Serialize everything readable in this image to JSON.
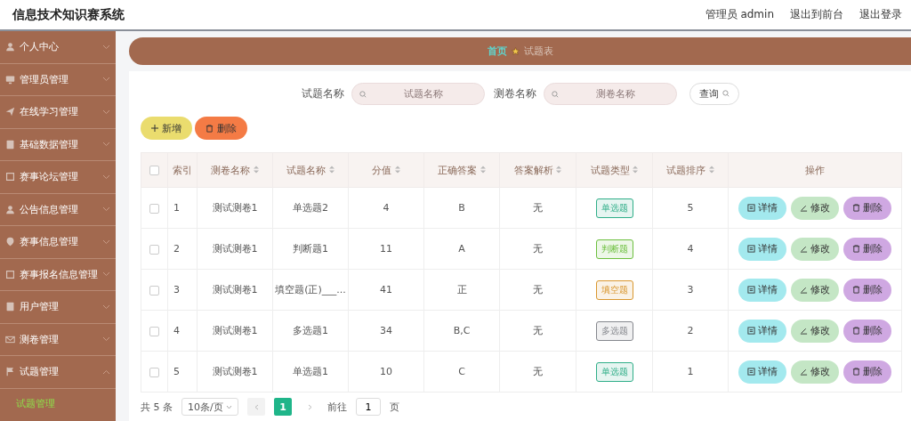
{
  "header": {
    "title": "信息技术知识赛系统",
    "user": "管理员 admin",
    "links": [
      "退出到前台",
      "退出登录"
    ]
  },
  "sidebar": {
    "items": [
      {
        "label": "个人中心",
        "expanded": false
      },
      {
        "label": "管理员管理",
        "expanded": false
      },
      {
        "label": "在线学习管理",
        "expanded": false
      },
      {
        "label": "基础数据管理",
        "expanded": false
      },
      {
        "label": "赛事论坛管理",
        "expanded": false
      },
      {
        "label": "公告信息管理",
        "expanded": false
      },
      {
        "label": "赛事信息管理",
        "expanded": false
      },
      {
        "label": "赛事报名信息管理",
        "expanded": false
      },
      {
        "label": "用户管理",
        "expanded": false
      },
      {
        "label": "测卷管理",
        "expanded": false
      },
      {
        "label": "试题管理",
        "expanded": true,
        "children": [
          {
            "label": "试题管理",
            "selected": true
          }
        ]
      }
    ]
  },
  "breadcrumb": {
    "home": "首页",
    "current": "试题表"
  },
  "search": {
    "fields": [
      {
        "label": "试题名称",
        "placeholder": "试题名称"
      },
      {
        "label": "测卷名称",
        "placeholder": "测卷名称"
      }
    ],
    "button": "查询"
  },
  "actions": {
    "add": "新增",
    "delete": "删除"
  },
  "table": {
    "header_checked": false,
    "columns": [
      {
        "label": "索引",
        "sortable": false
      },
      {
        "label": "测卷名称",
        "sortable": true
      },
      {
        "label": "试题名称",
        "sortable": true
      },
      {
        "label": "分值",
        "sortable": true
      },
      {
        "label": "正确答案",
        "sortable": true
      },
      {
        "label": "答案解析",
        "sortable": true
      },
      {
        "label": "试题类型",
        "sortable": true
      },
      {
        "label": "试题排序",
        "sortable": true
      },
      {
        "label": "操作",
        "sortable": false
      }
    ],
    "rows": [
      {
        "checked": false,
        "index": "1",
        "paper": "测试测卷1",
        "name": "单选题2",
        "score": "4",
        "answer": "B",
        "analysis": "无",
        "type": {
          "text": "单选题",
          "color": "#2fae88"
        },
        "order": "5",
        "buttons": [
          "详情",
          "修改",
          "删除"
        ]
      },
      {
        "checked": false,
        "index": "2",
        "paper": "测试测卷1",
        "name": "判断题1",
        "score": "11",
        "answer": "A",
        "analysis": "无",
        "type": {
          "text": "判断题",
          "color": "#6cbf3e"
        },
        "order": "4",
        "buttons": [
          "详情",
          "修改",
          "删除"
        ]
      },
      {
        "checked": false,
        "index": "3",
        "paper": "测试测卷1",
        "name": "填空题(正)___...",
        "score": "41",
        "answer": "正",
        "analysis": "无",
        "type": {
          "text": "填空题",
          "color": "#d9972f"
        },
        "order": "3",
        "buttons": [
          "详情",
          "修改",
          "删除"
        ]
      },
      {
        "checked": false,
        "index": "4",
        "paper": "测试测卷1",
        "name": "多选题1",
        "score": "34",
        "answer": "B,C",
        "analysis": "无",
        "type": {
          "text": "多选题",
          "color": "#85878d"
        },
        "order": "2",
        "buttons": [
          "详情",
          "修改",
          "删除"
        ]
      },
      {
        "checked": false,
        "index": "5",
        "paper": "测试测卷1",
        "name": "单选题1",
        "score": "10",
        "answer": "C",
        "analysis": "无",
        "type": {
          "text": "单选题",
          "color": "#2fae88"
        },
        "order": "1",
        "buttons": [
          "详情",
          "修改",
          "删除"
        ]
      }
    ]
  },
  "pagination": {
    "total": "共 5 条",
    "page_size": "10条/页",
    "pages": [
      {
        "label": "1",
        "selected": true
      }
    ],
    "goto_label": "前往",
    "goto_value": "1",
    "goto_suffix": "页"
  }
}
